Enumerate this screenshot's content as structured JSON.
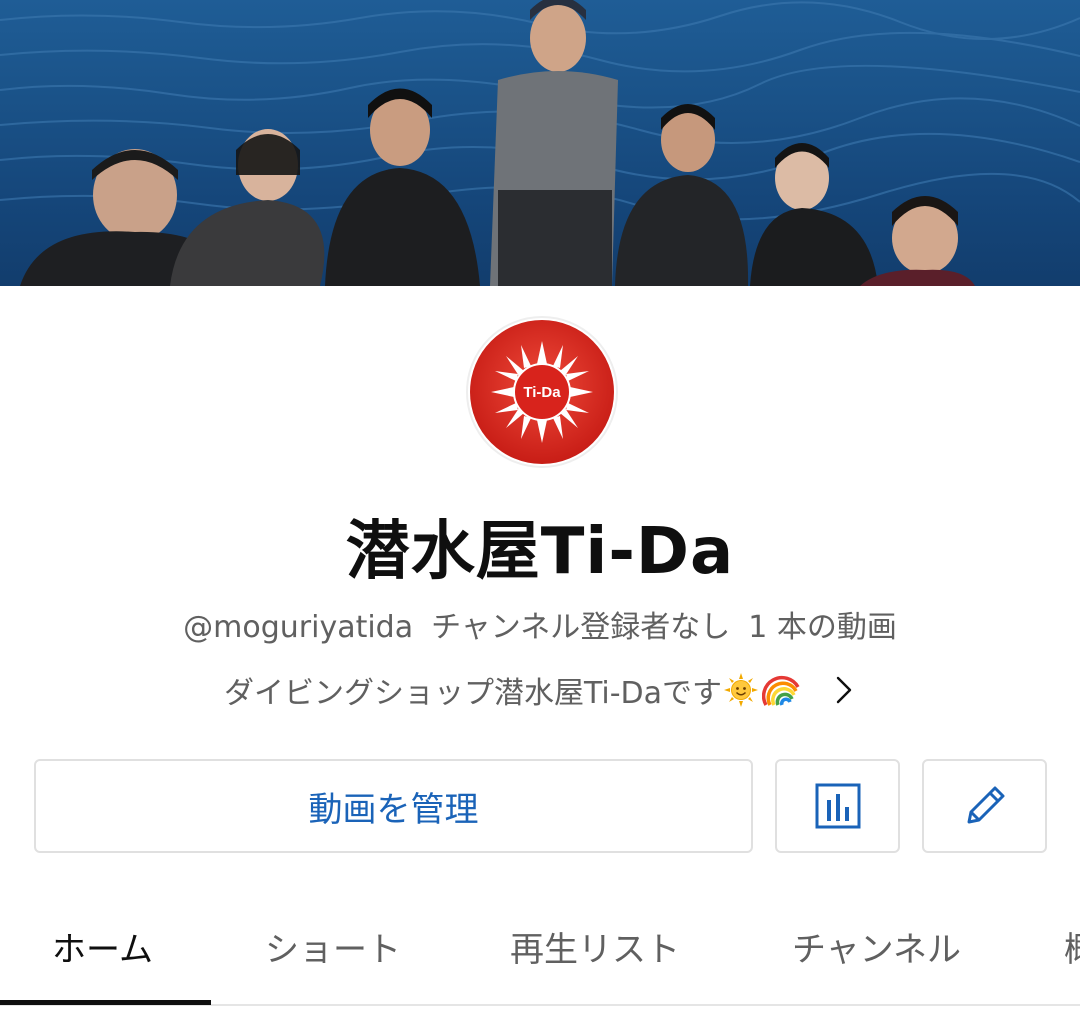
{
  "channel": {
    "name": "潜水屋Ti-Da",
    "handle": "@moguriyatida",
    "subscribers": "チャンネル登録者なし",
    "video_count": "1 本の動画",
    "description": "ダイビングショップ潜水屋Ti-Daです",
    "avatar_text": "Ti-Da"
  },
  "actions": {
    "manage_videos": "動画を管理",
    "stats_icon": "bar-chart-icon",
    "edit_icon": "pencil-icon"
  },
  "tabs": [
    {
      "label": "ホーム",
      "active": true
    },
    {
      "label": "ショート",
      "active": false
    },
    {
      "label": "再生リスト",
      "active": false
    },
    {
      "label": "チャンネル",
      "active": false
    },
    {
      "label": "概",
      "active": false
    }
  ],
  "colors": {
    "accent": "#1a63b8",
    "avatar_red": "#d8231c",
    "ocean": "#1a5288"
  }
}
